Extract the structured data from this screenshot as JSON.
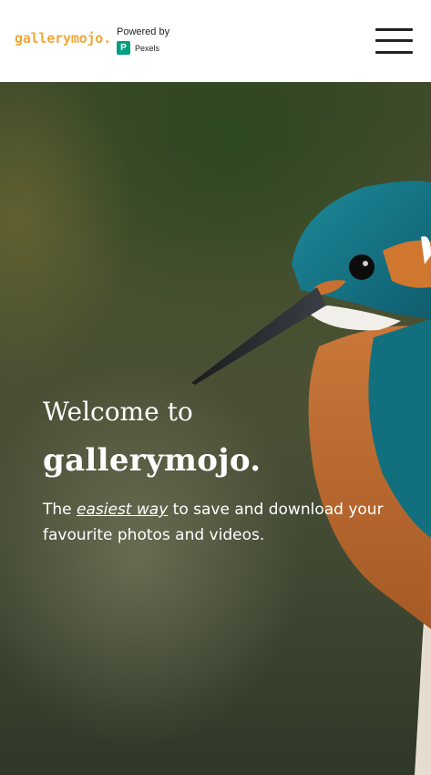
{
  "header": {
    "logo": "gallerymojo.",
    "powered_by": "Powered by",
    "pexels_icon_letter": "P",
    "pexels_label": "Pexels",
    "menu_icon": "hamburger-menu-icon"
  },
  "hero": {
    "welcome": "Welcome to",
    "brand": "gallerymojo.",
    "tagline_before": "The ",
    "tagline_link": "easiest way",
    "tagline_after": " to save and download your favourite photos and videos.",
    "image": "kingfisher-bird-photo"
  },
  "colors": {
    "logo": "#f0a83a",
    "pexels": "#05a081",
    "hero_text": "#ffffff"
  }
}
